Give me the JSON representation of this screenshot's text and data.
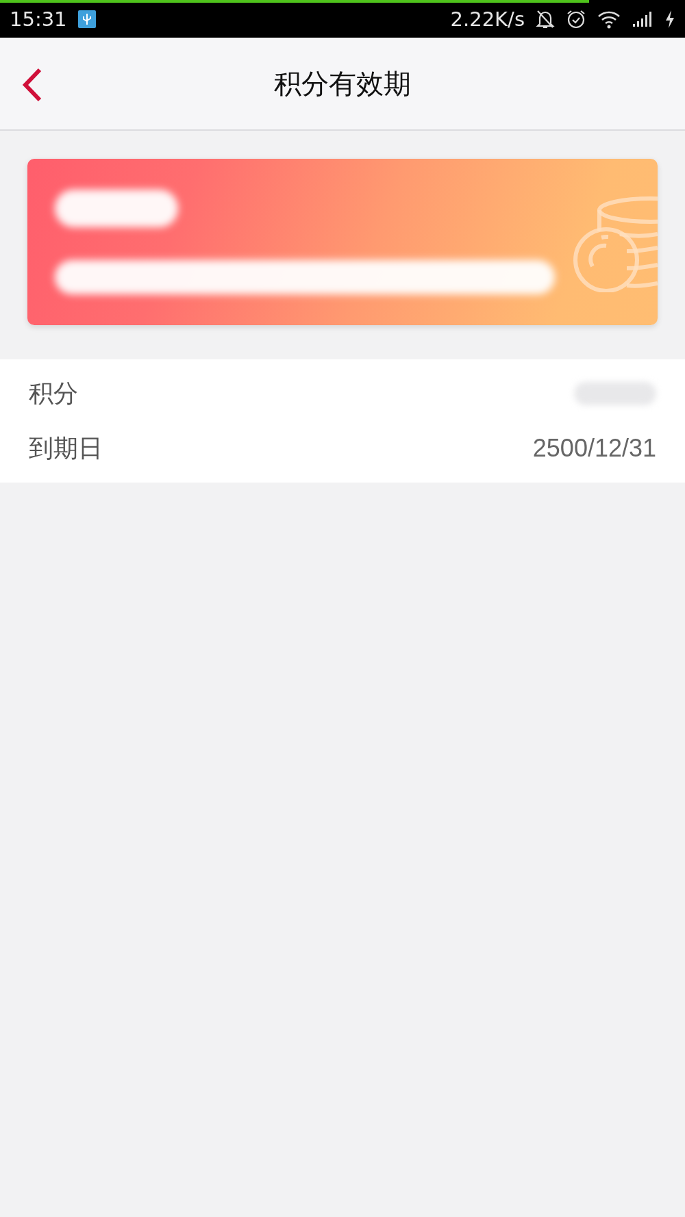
{
  "status_bar": {
    "time": "15:31",
    "speed": "2.22K/s",
    "loading_bar": {
      "level": 0.86
    }
  },
  "header": {
    "title": "积分有效期"
  },
  "details": [
    {
      "label": "积分",
      "value_redacted": true
    },
    {
      "label": "到期日",
      "value": "2500/12/31"
    }
  ]
}
